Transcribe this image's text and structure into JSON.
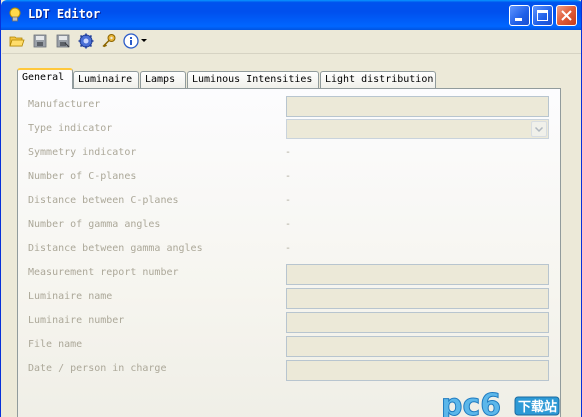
{
  "window": {
    "title": "LDT Editor"
  },
  "toolbar": {
    "tools": [
      "open-folder-icon",
      "save-icon",
      "save-as-icon",
      "settings-icon",
      "key-icon",
      "info-icon"
    ]
  },
  "tabs": [
    {
      "label": "General"
    },
    {
      "label": "Luminaire"
    },
    {
      "label": "Lamps"
    },
    {
      "label": "Luminous Intensities"
    },
    {
      "label": "Light distribution"
    }
  ],
  "fields": {
    "manufacturer": {
      "label": "Manufacturer",
      "value": ""
    },
    "type_indicator": {
      "label": "Type indicator",
      "value": ""
    },
    "symmetry_indicator": {
      "label": "Symmetry indicator",
      "value": "-"
    },
    "number_c_planes": {
      "label": "Number of C-planes",
      "value": "-"
    },
    "distance_c_planes": {
      "label": "Distance between C-planes",
      "value": "-"
    },
    "number_gamma": {
      "label": "Number of gamma angles",
      "value": "-"
    },
    "distance_gamma": {
      "label": "Distance between gamma angles",
      "value": "-"
    },
    "measurement_report": {
      "label": "Measurement report number",
      "value": ""
    },
    "luminaire_name": {
      "label": "Luminaire name",
      "value": ""
    },
    "luminaire_number": {
      "label": "Luminaire number",
      "value": ""
    },
    "file_name": {
      "label": "File name",
      "value": ""
    },
    "date_person": {
      "label": "Date / person in charge",
      "value": ""
    }
  },
  "watermark": {
    "text": "pc6",
    "badge": "下载站"
  }
}
